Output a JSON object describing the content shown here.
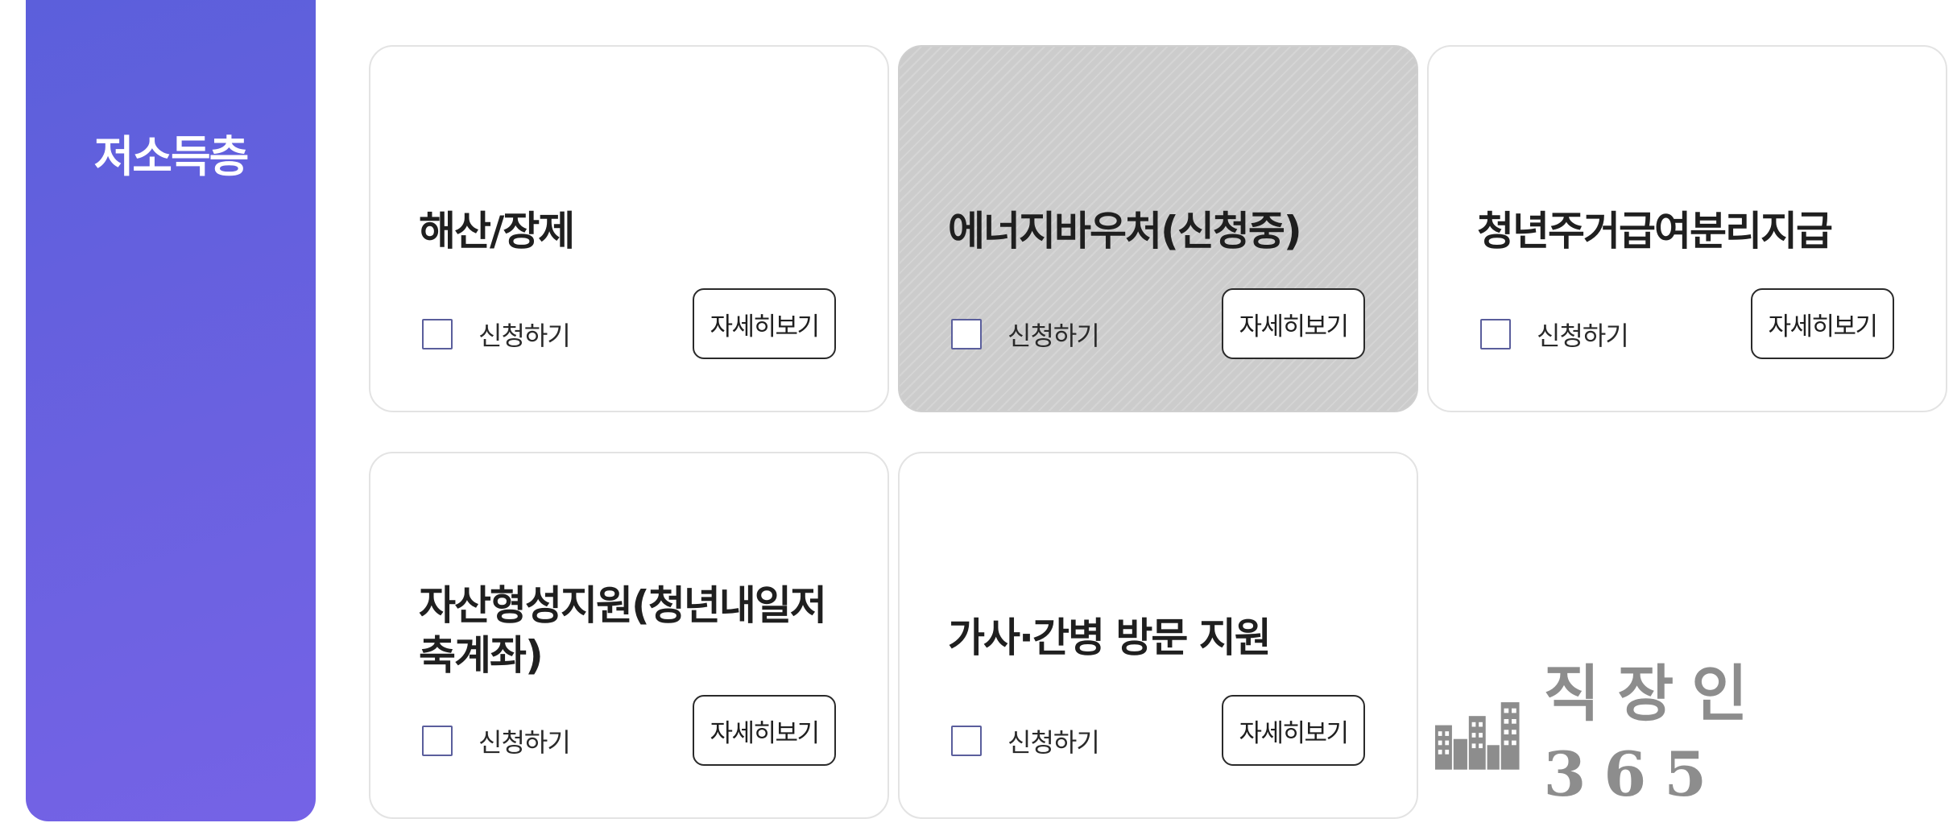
{
  "category": {
    "title": "저소득층",
    "color": "#6a61e0"
  },
  "cards": [
    {
      "title": "해산/장제",
      "apply_label": "신청하기",
      "detail_label": "자세히보기",
      "checked": false,
      "disabled": false
    },
    {
      "title": "에너지바우처(신청중)",
      "apply_label": "신청하기",
      "detail_label": "자세히보기",
      "checked": false,
      "disabled": true
    },
    {
      "title": "청년주거급여분리지급",
      "apply_label": "신청하기",
      "detail_label": "자세히보기",
      "checked": false,
      "disabled": false
    },
    {
      "title": "자산형성지원(청년내일저축계좌)",
      "apply_label": "신청하기",
      "detail_label": "자세히보기",
      "checked": false,
      "disabled": false
    },
    {
      "title": "가사·간병 방문 지원",
      "apply_label": "신청하기",
      "detail_label": "자세히보기",
      "checked": false,
      "disabled": false
    }
  ],
  "watermark": {
    "text": "직장인365",
    "icon": "building-icon"
  }
}
